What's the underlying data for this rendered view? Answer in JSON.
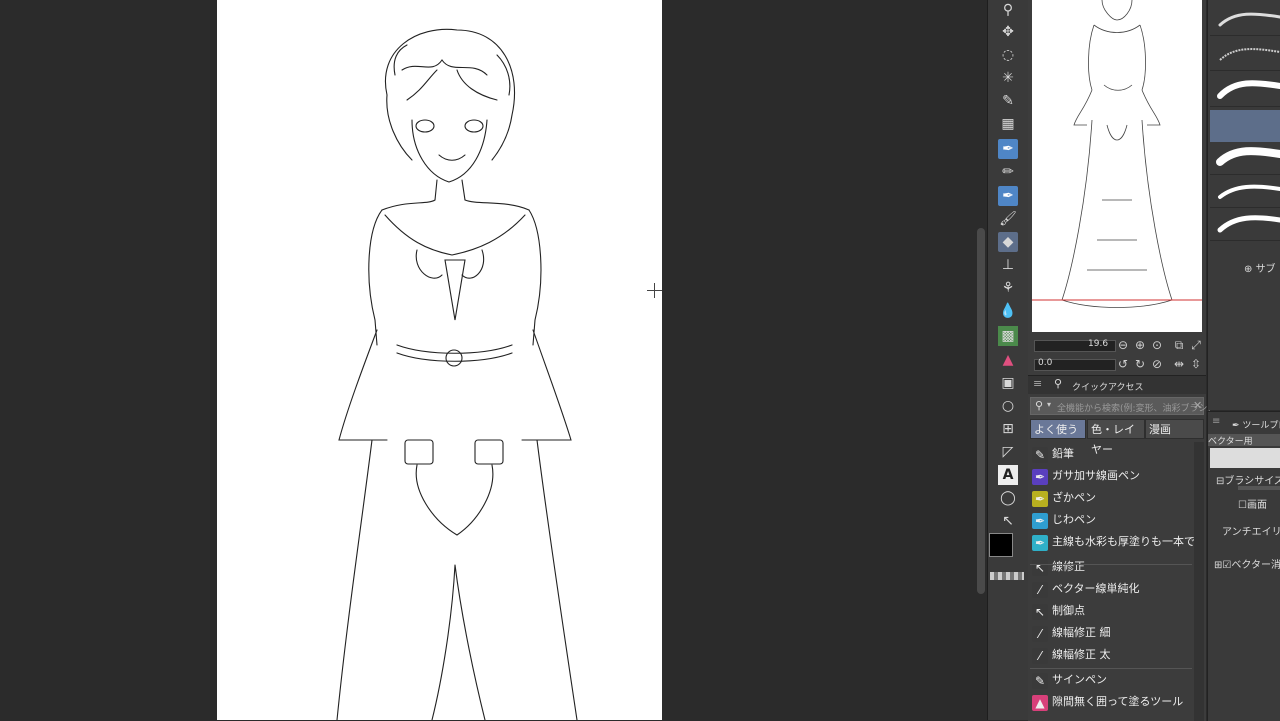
{
  "navigator": {
    "zoom": "19.6",
    "rotation": "0.0"
  },
  "quick_access": {
    "title": "クイックアクセス",
    "search_placeholder": "全機能から検索(例:変形、油彩ブラシ)",
    "tabs": [
      "よく使う",
      "色・レイヤー",
      "漫画"
    ],
    "items": [
      {
        "label": "鉛筆",
        "icon": "pencil-icon",
        "color": "#3a3a3a"
      },
      {
        "label": "ガサ加サ線画ペン",
        "icon": "pen-icon",
        "color": "#5a3fbf"
      },
      {
        "label": "ざかペン",
        "icon": "pen-icon",
        "color": "#b8b020"
      },
      {
        "label": "じわペン",
        "icon": "pen-icon",
        "color": "#2f9ed0"
      },
      {
        "label": "主線も水彩も厚塗りも一本でやる者たちの",
        "icon": "pen-icon",
        "color": "#2fb0c8"
      },
      {
        "label": "線修正",
        "icon": "correct-line-icon",
        "color": "#3a3a3a"
      },
      {
        "label": "ベクター線単純化",
        "icon": "brush-icon",
        "color": "#3a3a3a"
      },
      {
        "label": "制御点",
        "icon": "control-point-icon",
        "color": "#3a3a3a"
      },
      {
        "label": "線幅修正 細",
        "icon": "brush-icon",
        "color": "#3a3a3a"
      },
      {
        "label": "線幅修正 太",
        "icon": "brush-icon",
        "color": "#3a3a3a"
      },
      {
        "label": "サインペン",
        "icon": "pencil-icon",
        "color": "#3a3a3a"
      },
      {
        "label": "隙間無く囲って塗るツール",
        "icon": "fill-icon",
        "color": "#d8407a"
      }
    ]
  },
  "brush_panel": {
    "sub_tool_label": "サブ"
  },
  "tool_property": {
    "title": "ツールプロ",
    "preset": "ベクター用",
    "brush_size": "ブラシサイズ",
    "screen": "画面",
    "antialias": "アンチエイリア",
    "vector": "ベクター消"
  }
}
